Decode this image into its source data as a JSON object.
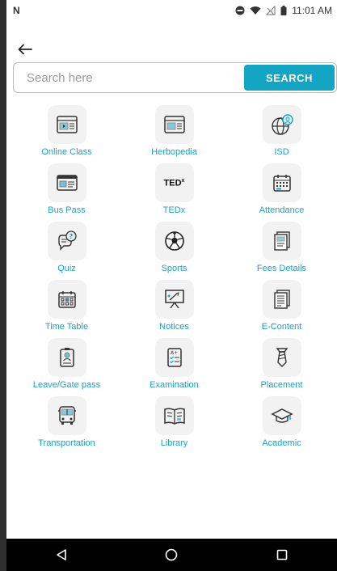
{
  "status_bar": {
    "carrier_glyph": "N",
    "time": "11:01 AM"
  },
  "search": {
    "placeholder": "Search here",
    "value": "",
    "button_label": "SEARCH"
  },
  "menu": {
    "items": [
      {
        "label": "Online Class",
        "icon": "video-class-icon"
      },
      {
        "label": "Herbopedia",
        "icon": "herbopedia-screen-icon"
      },
      {
        "label": "ISD",
        "icon": "globe-user-icon"
      },
      {
        "label": "Bus Pass",
        "icon": "bus-pass-card-icon"
      },
      {
        "label": "TEDx",
        "icon": "tedx-logo-icon",
        "icon_text": "TED",
        "icon_sup": "x"
      },
      {
        "label": "Attendance",
        "icon": "calendar-icon"
      },
      {
        "label": "Quiz",
        "icon": "quiz-bubble-icon"
      },
      {
        "label": "Sports",
        "icon": "soccer-ball-icon"
      },
      {
        "label": "Fees Details",
        "icon": "fees-document-icon"
      },
      {
        "label": "Time Table",
        "icon": "timetable-calendar-icon"
      },
      {
        "label": "Notices",
        "icon": "notice-board-icon"
      },
      {
        "label": "E-Content",
        "icon": "e-content-document-icon"
      },
      {
        "label": "Leave/Gate pass",
        "icon": "id-badge-icon"
      },
      {
        "label": "Examination",
        "icon": "exam-checklist-icon"
      },
      {
        "label": "Placement",
        "icon": "tie-icon"
      },
      {
        "label": "Transportation",
        "icon": "bus-icon"
      },
      {
        "label": "Library",
        "icon": "open-book-icon"
      },
      {
        "label": "Academic",
        "icon": "graduation-cap-icon"
      }
    ]
  },
  "colors": {
    "accent": "#12a5c4",
    "label": "#1aa3c5",
    "icon_stroke": "#333333"
  }
}
